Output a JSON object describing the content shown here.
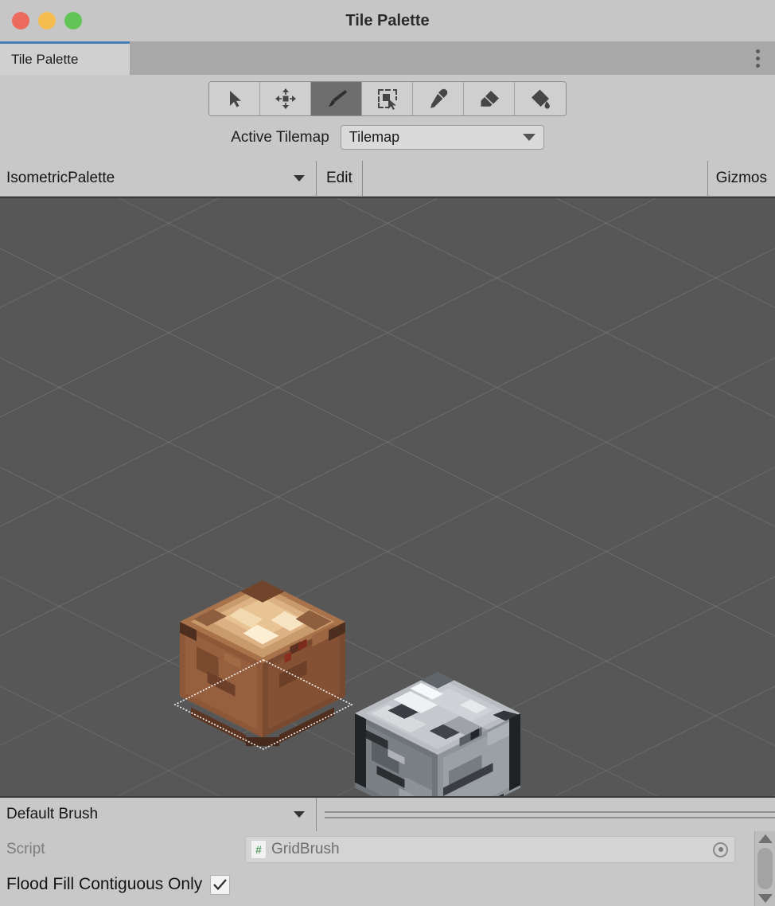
{
  "window": {
    "title": "Tile Palette",
    "traffic_lights": [
      {
        "name": "close",
        "color": "#ec6a5e"
      },
      {
        "name": "minimize",
        "color": "#f5bd4f"
      },
      {
        "name": "maximize",
        "color": "#61c454"
      }
    ]
  },
  "tabs": [
    {
      "label": "Tile Palette",
      "active": true
    }
  ],
  "tab_menu_icon": "kebab-menu-icon",
  "toolbar": {
    "tools": [
      {
        "name": "select-tool",
        "icon": "cursor-arrow-icon",
        "active": false
      },
      {
        "name": "move-tool",
        "icon": "move-arrows-icon",
        "active": false
      },
      {
        "name": "paint-tool",
        "icon": "paintbrush-icon",
        "active": true
      },
      {
        "name": "box-fill-tool",
        "icon": "marquee-select-icon",
        "active": false
      },
      {
        "name": "picker-tool",
        "icon": "eyedropper-icon",
        "active": false
      },
      {
        "name": "erase-tool",
        "icon": "eraser-icon",
        "active": false
      },
      {
        "name": "fill-tool",
        "icon": "paint-bucket-icon",
        "active": false
      }
    ]
  },
  "active_tilemap": {
    "label": "Active Tilemap",
    "value": "Tilemap"
  },
  "palette_bar": {
    "palette_name": "IsometricPalette",
    "edit_label": "Edit",
    "gizmos_label": "Gizmos"
  },
  "canvas": {
    "background_color": "#575757",
    "grid": "isometric",
    "tiles": [
      {
        "name": "dirt-tile",
        "selected": true
      },
      {
        "name": "stone-tile",
        "selected": false
      }
    ],
    "selection_outline_color": "#ffffff"
  },
  "brush_bar": {
    "brush_name": "Default Brush"
  },
  "inspector": {
    "script_label": "Script",
    "script_value": "GridBrush",
    "script_icon": "csharp-script-icon",
    "object_picker_icon": "object-picker-icon",
    "flood_fill_label": "Flood Fill Contiguous Only",
    "flood_fill_checked": true
  },
  "scrollbar": {
    "up_icon": "scroll-up-arrow-icon",
    "down_icon": "scroll-down-arrow-icon"
  }
}
